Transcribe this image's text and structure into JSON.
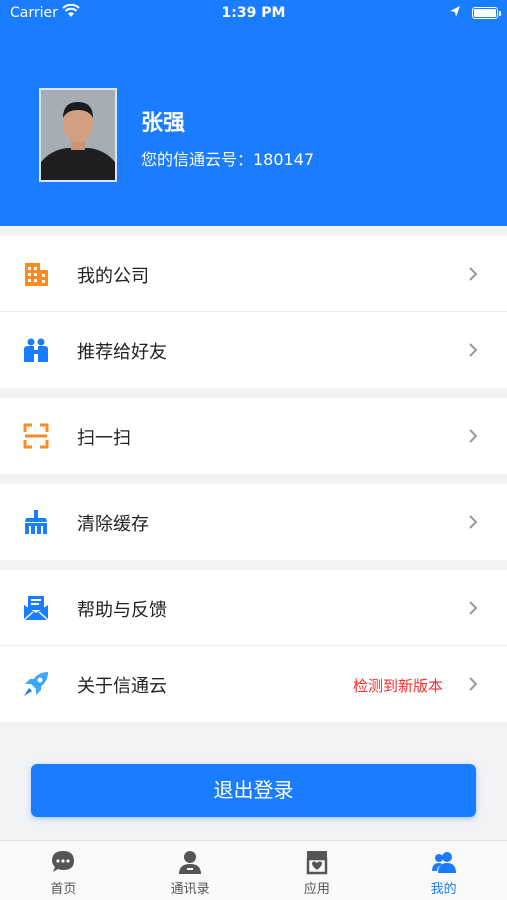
{
  "status_bar": {
    "carrier": "Carrier",
    "time": "1:39 PM"
  },
  "profile": {
    "name": "张强",
    "id_text": "您的信通云号：180147"
  },
  "menu": {
    "company": {
      "label": "我的公司",
      "icon": "building-icon"
    },
    "recommend": {
      "label": "推荐给好友",
      "icon": "friends-icon"
    },
    "scan": {
      "label": "扫一扫",
      "icon": "scan-icon"
    },
    "clear_cache": {
      "label": "清除缓存",
      "icon": "broom-icon"
    },
    "help": {
      "label": "帮助与反馈",
      "icon": "mail-icon"
    },
    "about": {
      "label": "关于信通云",
      "icon": "rocket-icon",
      "badge": "检测到新版本"
    }
  },
  "logout_label": "退出登录",
  "tabs": [
    {
      "label": "首页",
      "icon": "chat-icon",
      "active": false
    },
    {
      "label": "通讯录",
      "icon": "contact-icon",
      "active": false
    },
    {
      "label": "应用",
      "icon": "store-icon",
      "active": false
    },
    {
      "label": "我的",
      "icon": "user-icon",
      "active": true
    }
  ],
  "colors": {
    "primary": "#1a7cff",
    "alert": "#ff2a2a",
    "orange": "#ff8a1f"
  }
}
